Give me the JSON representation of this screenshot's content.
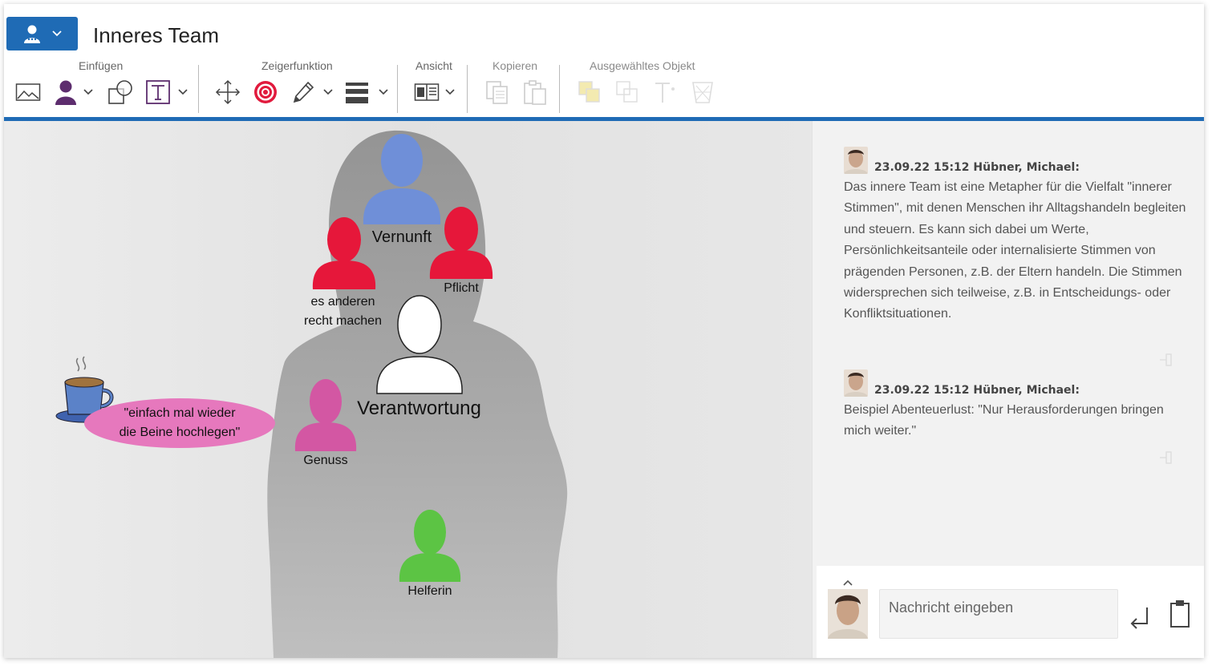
{
  "header": {
    "title": "Inneres Team"
  },
  "toolbar": {
    "groups": [
      {
        "label": "Einfügen"
      },
      {
        "label": "Zeigerfunktion"
      },
      {
        "label": "Ansicht"
      },
      {
        "label": "Kopieren"
      },
      {
        "label": "Ausgewähltes Objekt"
      }
    ],
    "icons": {
      "insert_image": "image-icon",
      "insert_person": "person-icon",
      "insert_shape": "shapes-icon",
      "insert_text": "text-icon",
      "move": "move-arrows-icon",
      "target": "target-icon",
      "pen": "pen-icon",
      "line_style": "line-style-icon",
      "view": "book-view-icon",
      "copy": "copy-icon",
      "paste": "paste-icon"
    },
    "accent_color": "#1f6bb5"
  },
  "canvas": {
    "figures": [
      {
        "label": "Vernunft",
        "color": "#6f8fd8"
      },
      {
        "label": "es anderen\nrecht machen",
        "color": "#e6173a"
      },
      {
        "label": "Pflicht",
        "color": "#e6173a"
      },
      {
        "label": "Verantwortung",
        "color": "#ffffff"
      },
      {
        "label": "Genuss",
        "color": "#d357a3"
      },
      {
        "label": "Helferin",
        "color": "#5cc444"
      }
    ],
    "speech_bubble": "\"einfach mal wieder die Beine hochlegen\"",
    "speech_line1": "\"einfach mal wieder",
    "speech_line2": "die Beine hochlegen\"",
    "es_line1": "es anderen",
    "es_line2": "recht machen"
  },
  "chat": {
    "messages": [
      {
        "header": "23.09.22 15:12 Hübner, Michael:",
        "body": "Das innere Team ist eine Metapher für die Vielfalt \"innerer Stimmen\", mit denen Menschen ihr Alltagshandeln begleiten und steuern. Es kann sich dabei um Werte, Persönlichkeitsanteile oder internalisierte Stimmen von prägenden Personen, z.B. der Eltern handeln. Die Stimmen widersprechen sich teilweise, z.B. in Entscheidungs- oder Konfliktsituationen."
      },
      {
        "header": "23.09.22 15:12 Hübner, Michael:",
        "body": "Beispiel Abenteuerlust: \"Nur Herausforderungen bringen mich weiter.\""
      }
    ],
    "input_placeholder": "Nachricht eingeben"
  }
}
